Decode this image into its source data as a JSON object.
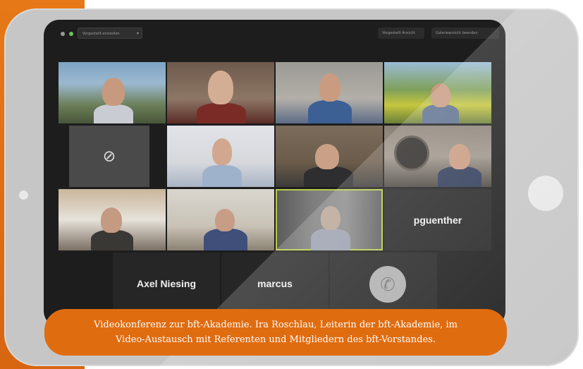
{
  "toolbar": {
    "view_select": "Vorgestellt einstellen",
    "speaker_view": "Vorgestellt Ansicht",
    "gallery_view": "Galerieansicht beenden"
  },
  "participants": [
    {
      "label": "Axel Niesing"
    },
    {
      "label": "marcus"
    },
    {
      "label": "pguenther"
    }
  ],
  "caption": {
    "line1": "Videokonferenz zur bft-Akademie. Ira Roschlau, Leiterin der bft-Akademie, im",
    "line2": "Video-Austausch mit Referenten und Mitgliedern des bft-Vorstandes."
  },
  "colors": {
    "accent": "#e06c10",
    "tablet": "#c6c6c6",
    "screen": "#1d1d1d"
  }
}
